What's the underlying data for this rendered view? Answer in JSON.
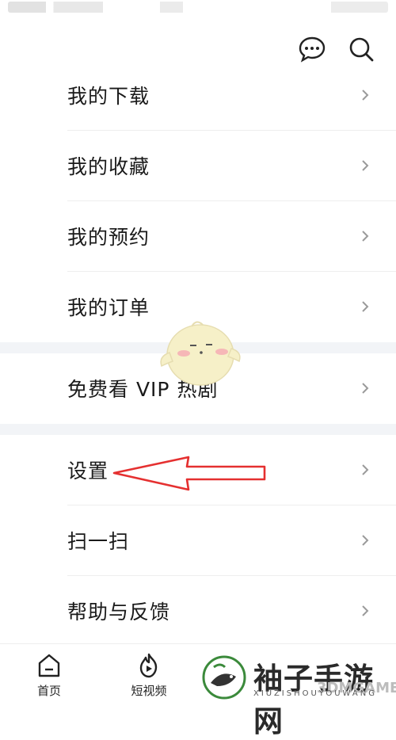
{
  "status_bar": {
    "visible": true
  },
  "header": {
    "icons": [
      "message-icon",
      "search-icon"
    ]
  },
  "menu_group_1": [
    {
      "label": "我的下载"
    },
    {
      "label": "我的收藏"
    },
    {
      "label": "我的预约"
    },
    {
      "label": "我的订单"
    }
  ],
  "menu_group_2": [
    {
      "label": "免费看 VIP 热剧"
    }
  ],
  "menu_group_3": [
    {
      "label": "设置"
    },
    {
      "label": "扫一扫"
    },
    {
      "label": "帮助与反馈"
    }
  ],
  "annotation": {
    "arrow_color": "#e53030",
    "points_to": "设置"
  },
  "bottom_nav": {
    "home_label": "首页",
    "short_video_label": "短视频"
  },
  "watermark": {
    "title": "袖子手游网",
    "subtitle": "XIUZISHOUYOUWANG",
    "overlay": "3DMGAME"
  },
  "colors": {
    "accent": "#e53030",
    "gap": "#f2f4f7",
    "divider": "#eeeeee",
    "mascot": "#f6f0c8"
  }
}
